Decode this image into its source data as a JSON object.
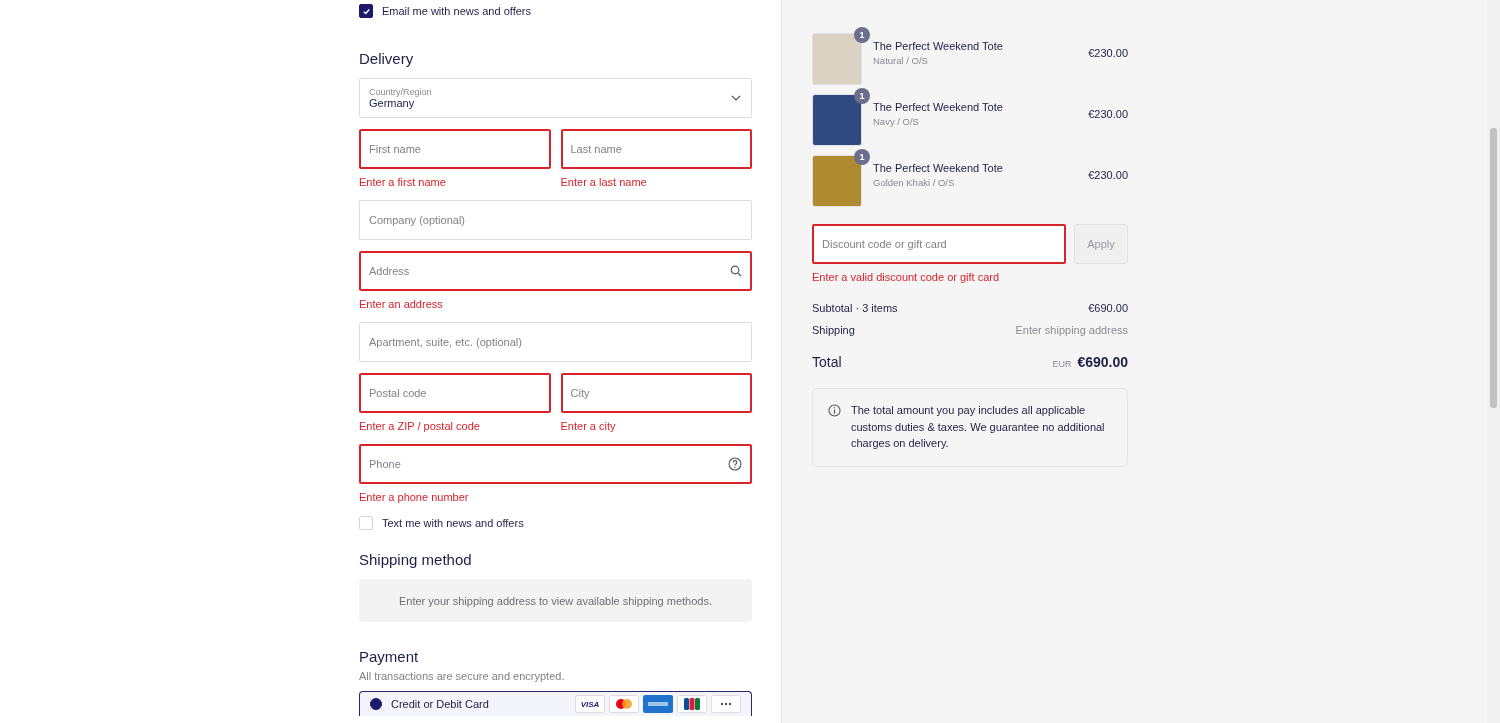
{
  "email_optin": {
    "label": "Email me with news and offers",
    "checked": true
  },
  "delivery": {
    "title": "Delivery",
    "rows": [
      {
        "fields": [
          {
            "kind": "select",
            "label": "Country/Region",
            "value": "Germany",
            "invalid": false
          }
        ]
      },
      {
        "fields": [
          {
            "kind": "text",
            "placeholder": "First name",
            "invalid": true,
            "error": "Enter a first name"
          },
          {
            "kind": "text",
            "placeholder": "Last name",
            "invalid": true,
            "error": "Enter a last name"
          }
        ]
      },
      {
        "fields": [
          {
            "kind": "text",
            "placeholder": "Company (optional)",
            "invalid": false
          }
        ]
      },
      {
        "fields": [
          {
            "kind": "search",
            "placeholder": "Address",
            "invalid": true,
            "error": "Enter an address"
          }
        ]
      },
      {
        "fields": [
          {
            "kind": "text",
            "placeholder": "Apartment, suite, etc. (optional)",
            "invalid": false
          }
        ]
      },
      {
        "fields": [
          {
            "kind": "text",
            "placeholder": "Postal code",
            "invalid": true,
            "error": "Enter a ZIP / postal code"
          },
          {
            "kind": "text",
            "placeholder": "City",
            "invalid": true,
            "error": "Enter a city"
          }
        ]
      },
      {
        "fields": [
          {
            "kind": "help",
            "placeholder": "Phone",
            "invalid": true,
            "error": "Enter a phone number"
          }
        ]
      }
    ]
  },
  "sms_optin": {
    "label": "Text me with news and offers",
    "checked": false
  },
  "shipping_method": {
    "title": "Shipping method",
    "message": "Enter your shipping address to view available shipping methods."
  },
  "payment": {
    "title": "Payment",
    "subtitle": "All transactions are secure and encrypted.",
    "option": {
      "label": "Credit or Debit Card",
      "selected": true,
      "cards": [
        {
          "kind": "visa",
          "label": "VISA"
        },
        {
          "kind": "mastercard"
        },
        {
          "kind": "amex"
        },
        {
          "kind": "jcb"
        },
        {
          "kind": "more"
        }
      ]
    }
  },
  "order": {
    "items": [
      {
        "name": "The Perfect Weekend Tote",
        "variant": "Natural / O/S",
        "price": "€230.00",
        "quantity": "1",
        "color": "#d9d2c3"
      },
      {
        "name": "The Perfect Weekend Tote",
        "variant": "Navy / O/S",
        "price": "€230.00",
        "quantity": "1",
        "color": "#2f4a80"
      },
      {
        "name": "The Perfect Weekend Tote",
        "variant": "Golden Khaki / O/S",
        "price": "€230.00",
        "quantity": "1",
        "color": "#b08a2e"
      }
    ],
    "discount": {
      "placeholder": "Discount code or gift card",
      "invalid": true,
      "error": "Enter a valid discount code or gift card",
      "button": "Apply",
      "disabled": true
    },
    "subtotal": {
      "label": "Subtotal · 3 items",
      "value": "€690.00"
    },
    "shipping": {
      "label": "Shipping",
      "value": "Enter shipping address"
    },
    "total": {
      "label": "Total",
      "currency": "EUR",
      "value": "€690.00"
    },
    "notice": "The total amount you pay includes all applicable customs duties & taxes. We guarantee no additional charges on delivery."
  }
}
